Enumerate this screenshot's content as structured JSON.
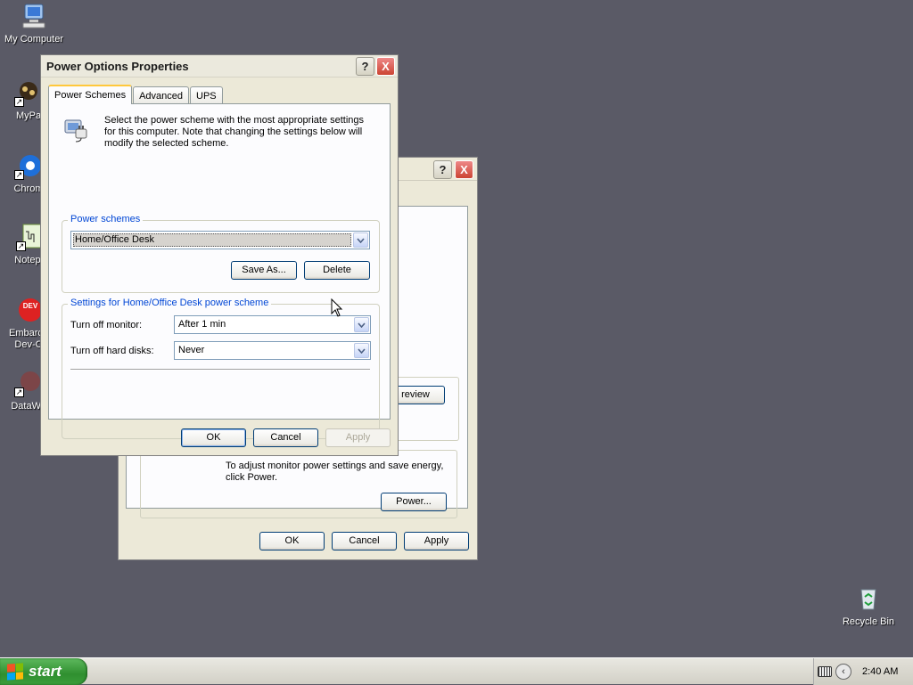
{
  "desktop": {
    "icons": [
      {
        "label": "My Computer"
      },
      {
        "label": "MyPa"
      },
      {
        "label": "Chrom"
      },
      {
        "label": "Notepa"
      },
      {
        "label": "Embarca\nDev-C"
      },
      {
        "label": "DataWa"
      },
      {
        "label": "Recycle Bin"
      }
    ]
  },
  "background_window": {
    "help": "?",
    "close": "X",
    "preview_label": "review",
    "description": "To adjust monitor power settings and save energy, click Power.",
    "power_label": "Power...",
    "ok_label": "OK",
    "cancel_label": "Cancel",
    "apply_label": "Apply"
  },
  "dialog": {
    "title": "Power Options Properties",
    "help": "?",
    "close": "X",
    "tabs": [
      {
        "label": "Power Schemes",
        "active": true
      },
      {
        "label": "Advanced",
        "active": false
      },
      {
        "label": "UPS",
        "active": false
      }
    ],
    "intro": "Select the power scheme with the most appropriate settings for this computer. Note that changing the settings below will modify the selected scheme.",
    "schemes_group": {
      "title": "Power schemes",
      "selected": "Home/Office Desk",
      "save_as_label": "Save As...",
      "delete_label": "Delete"
    },
    "settings_group": {
      "title": "Settings for Home/Office Desk power scheme",
      "monitor_label": "Turn off monitor:",
      "monitor_value": "After 1 min",
      "disks_label": "Turn off hard disks:",
      "disks_value": "Never"
    },
    "ok_label": "OK",
    "cancel_label": "Cancel",
    "apply_label": "Apply"
  },
  "taskbar": {
    "start_label": "start",
    "clock": "2:40 AM"
  },
  "colors": {
    "desktop": "#5a5a66",
    "group_title": "#0046d5",
    "start_green": "#2f8f2f"
  }
}
